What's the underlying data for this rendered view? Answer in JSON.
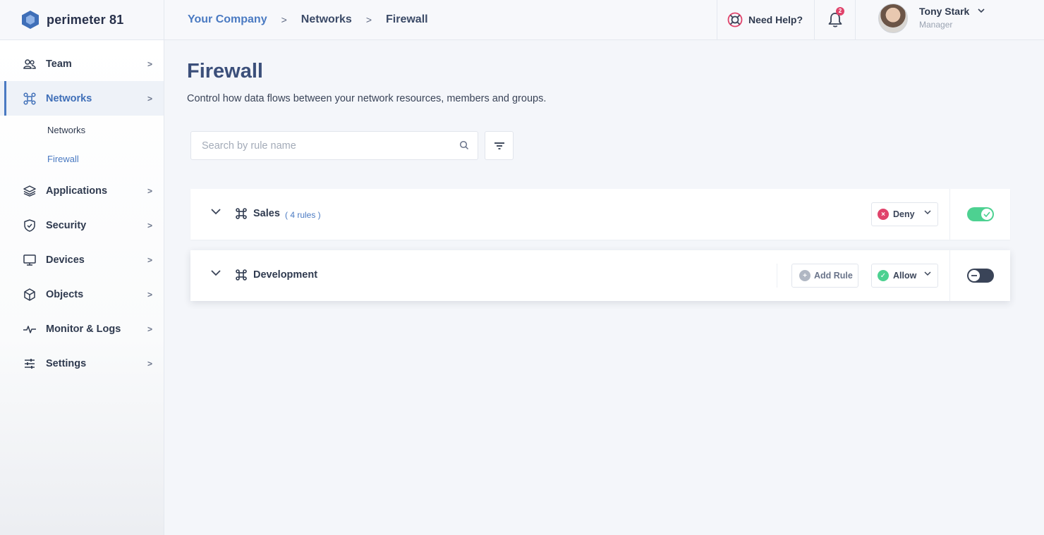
{
  "app": {
    "brand": "perimeter 81"
  },
  "breadcrumb": [
    {
      "label": "Your Company"
    },
    {
      "label": "Networks"
    },
    {
      "label": "Firewall"
    }
  ],
  "header": {
    "help_label": "Need Help?",
    "notification_count": "2",
    "user_name": "Tony Stark",
    "user_role": "Manager"
  },
  "sidebar": {
    "items": [
      {
        "label": "Team",
        "icon": "team-icon"
      },
      {
        "label": "Networks",
        "icon": "networks-icon",
        "active": true
      },
      {
        "label": "Applications",
        "icon": "applications-icon"
      },
      {
        "label": "Security",
        "icon": "shield-icon"
      },
      {
        "label": "Devices",
        "icon": "monitor-icon"
      },
      {
        "label": "Objects",
        "icon": "cube-icon"
      },
      {
        "label": "Monitor & Logs",
        "icon": "pulse-icon"
      },
      {
        "label": "Settings",
        "icon": "sliders-icon"
      }
    ],
    "subitems": [
      {
        "label": "Networks"
      },
      {
        "label": "Firewall",
        "current": true
      }
    ]
  },
  "page": {
    "title": "Firewall",
    "description": "Control how data flows between your network resources, members and groups."
  },
  "search": {
    "placeholder": "Search by rule name",
    "value": ""
  },
  "groups": [
    {
      "name": "Sales",
      "rules_count": "( 4 rules )",
      "action": "Deny",
      "enabled": true
    },
    {
      "name": "Development",
      "add_rule_label": "Add Rule",
      "action": "Allow",
      "enabled": false
    }
  ],
  "colors": {
    "accent": "#4a7ac2",
    "deny": "#e0436b",
    "allow": "#4dd191",
    "toggle_off": "#3a4458"
  }
}
